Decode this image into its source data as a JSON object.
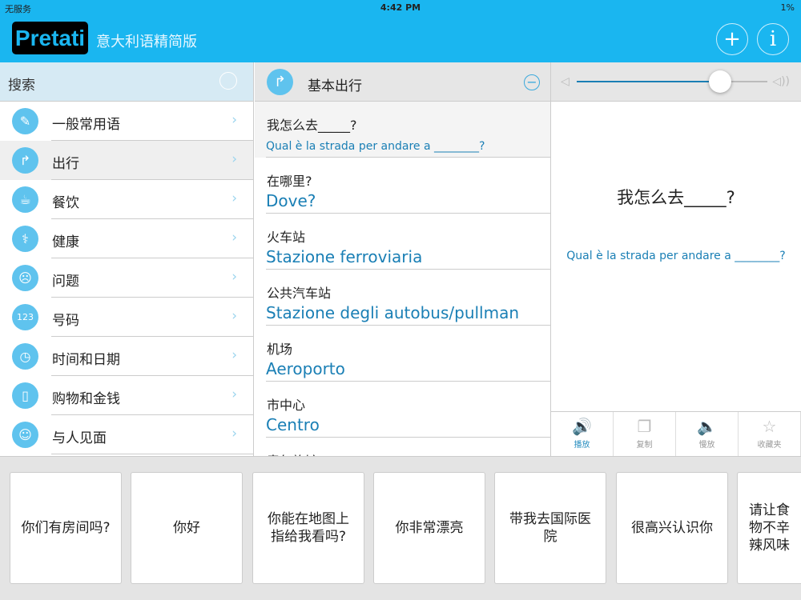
{
  "status": {
    "carrier": "无服务",
    "time": "4:42 PM",
    "battery": "1%"
  },
  "header": {
    "logo": "Pretati",
    "title": "意大利语精简版",
    "add": "+",
    "info": "i"
  },
  "search": {
    "placeholder": "搜索"
  },
  "categories": [
    {
      "label": "一般常用语",
      "icon": "✎"
    },
    {
      "label": "出行",
      "icon": "↱"
    },
    {
      "label": "餐饮",
      "icon": "☕"
    },
    {
      "label": "健康",
      "icon": "⚕"
    },
    {
      "label": "问题",
      "icon": "☹"
    },
    {
      "label": "号码",
      "icon": "123"
    },
    {
      "label": "时间和日期",
      "icon": "◷"
    },
    {
      "label": "购物和金钱",
      "icon": "▯"
    },
    {
      "label": "与人见面",
      "icon": "☺"
    }
  ],
  "section": {
    "title": "基本出行"
  },
  "phrases": [
    {
      "zh": "我怎么去_____?",
      "it": "Qual è la strada per andare a ________?"
    },
    {
      "zh": "在哪里?",
      "it": "Dove?"
    },
    {
      "zh": "火车站",
      "it": "Stazione ferroviaria"
    },
    {
      "zh": "公共汽车站",
      "it": "Stazione degli autobus/pullman"
    },
    {
      "zh": "机场",
      "it": "Aeroporto"
    },
    {
      "zh": "市中心",
      "it": "Centro"
    },
    {
      "zh": "青年旅馆",
      "it": ""
    }
  ],
  "detail": {
    "zh": "我怎么去_____?",
    "it": "Qual è la strada per andare a ________?",
    "volume": 0.75
  },
  "tools": [
    {
      "label": "播放",
      "icon": "🔊"
    },
    {
      "label": "复制",
      "icon": "❐"
    },
    {
      "label": "慢放",
      "icon": "🔈"
    },
    {
      "label": "收藏夹",
      "icon": "☆"
    }
  ],
  "cards": [
    "你们有房间吗?",
    "你好",
    "你能在地图上指给我看吗?",
    "你非常漂亮",
    "带我去国际医院",
    "很高兴认识你",
    "请让食物不辛辣风味"
  ]
}
